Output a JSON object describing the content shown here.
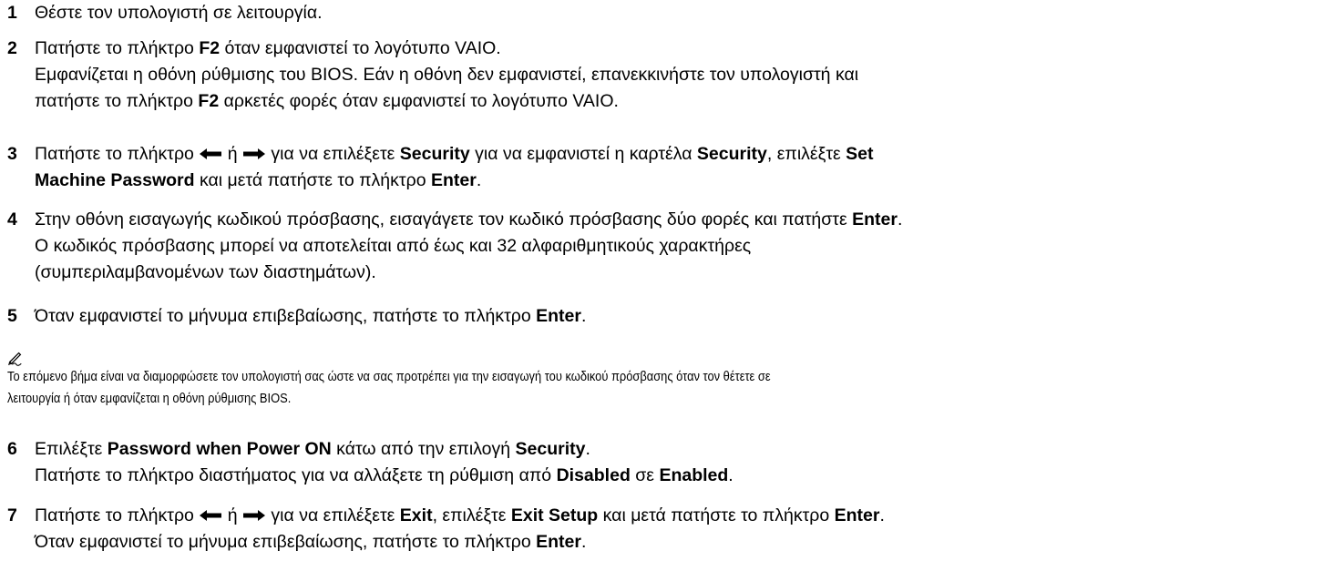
{
  "steps": [
    {
      "num": "1",
      "lines": [
        [
          {
            "t": "Θέστε τον υπολογιστή σε λειτουργία."
          }
        ]
      ]
    },
    {
      "num": "2",
      "lines": [
        [
          {
            "t": "Πατήστε το πλήκτρο "
          },
          {
            "t": "F2",
            "b": true
          },
          {
            "t": " όταν εμφανιστεί το λογότυπο VAIO."
          }
        ],
        [
          {
            "t": "Εμφανίζεται η οθόνη ρύθμισης του BIOS. Εάν η οθόνη δεν εμφανιστεί, επανεκκινήστε τον υπολογιστή και"
          }
        ],
        [
          {
            "t": "πατήστε το πλήκτρο "
          },
          {
            "t": "F2",
            "b": true
          },
          {
            "t": " αρκετές φορές όταν εμφανιστεί το λογότυπο VAIO."
          }
        ]
      ]
    },
    {
      "num": "3",
      "lines": [
        [
          {
            "t": "Πατήστε το πλήκτρο "
          },
          {
            "icon": "left-arrow-icon"
          },
          {
            "t": " ή "
          },
          {
            "icon": "right-arrow-icon"
          },
          {
            "t": " για να επιλέξετε "
          },
          {
            "t": "Security",
            "b": true
          },
          {
            "t": " για να εμφανιστεί η καρτέλα "
          },
          {
            "t": "Security",
            "b": true
          },
          {
            "t": ", επιλέξτε "
          },
          {
            "t": "Set",
            "b": true
          }
        ],
        [
          {
            "t": "Machine Password",
            "b": true
          },
          {
            "t": " και μετά πατήστε το πλήκτρο "
          },
          {
            "t": "Enter",
            "b": true
          },
          {
            "t": "."
          }
        ]
      ]
    },
    {
      "num": "4",
      "lines": [
        [
          {
            "t": "Στην οθόνη εισαγωγής κωδικού πρόσβασης, εισαγάγετε τον κωδικό πρόσβασης δύο φορές και πατήστε "
          },
          {
            "t": "Enter",
            "b": true
          },
          {
            "t": "."
          }
        ],
        [
          {
            "t": "Ο κωδικός πρόσβασης μπορεί να αποτελείται από έως και 32 αλφαριθμητικούς χαρακτήρες"
          }
        ],
        [
          {
            "t": "(συμπεριλαμβανομένων των διαστημάτων)."
          }
        ]
      ]
    },
    {
      "num": "5",
      "lines": [
        [
          {
            "t": "Όταν εμφανιστεί το μήνυμα επιβεβαίωσης, πατήστε το πλήκτρο "
          },
          {
            "t": "Enter",
            "b": true
          },
          {
            "t": "."
          }
        ]
      ]
    },
    {
      "num": "6",
      "lines": [
        [
          {
            "t": "Επιλέξτε "
          },
          {
            "t": "Password when Power ON",
            "b": true
          },
          {
            "t": " κάτω από την επιλογή "
          },
          {
            "t": "Security",
            "b": true
          },
          {
            "t": "."
          }
        ],
        [
          {
            "t": "Πατήστε το πλήκτρο διαστήματος για να αλλάξετε τη ρύθμιση από "
          },
          {
            "t": "Disabled",
            "b": true
          },
          {
            "t": " σε "
          },
          {
            "t": "Enabled",
            "b": true
          },
          {
            "t": "."
          }
        ]
      ]
    },
    {
      "num": "7",
      "lines": [
        [
          {
            "t": "Πατήστε το πλήκτρο "
          },
          {
            "icon": "left-arrow-icon"
          },
          {
            "t": " ή "
          },
          {
            "icon": "right-arrow-icon"
          },
          {
            "t": " για να επιλέξετε "
          },
          {
            "t": "Exit",
            "b": true
          },
          {
            "t": ", επιλέξτε "
          },
          {
            "t": "Exit Setup",
            "b": true
          },
          {
            "t": " και μετά πατήστε το πλήκτρο "
          },
          {
            "t": "Enter",
            "b": true
          },
          {
            "t": "."
          }
        ],
        [
          {
            "t": "Όταν εμφανιστεί το μήνυμα επιβεβαίωσης, πατήστε το πλήκτρο "
          },
          {
            "t": "Enter",
            "b": true
          },
          {
            "t": "."
          }
        ]
      ]
    }
  ],
  "note": {
    "icon": "note-pen-icon",
    "lines": [
      "Το επόμενο βήμα είναι να διαμορφώσετε τον υπολογιστή σας ώστε να σας προτρέπει για την εισαγωγή του κωδικού πρόσβασης όταν τον θέτετε σε",
      "λειτουργία ή όταν εμφανίζεται η οθόνη ρύθμισης BIOS."
    ]
  }
}
